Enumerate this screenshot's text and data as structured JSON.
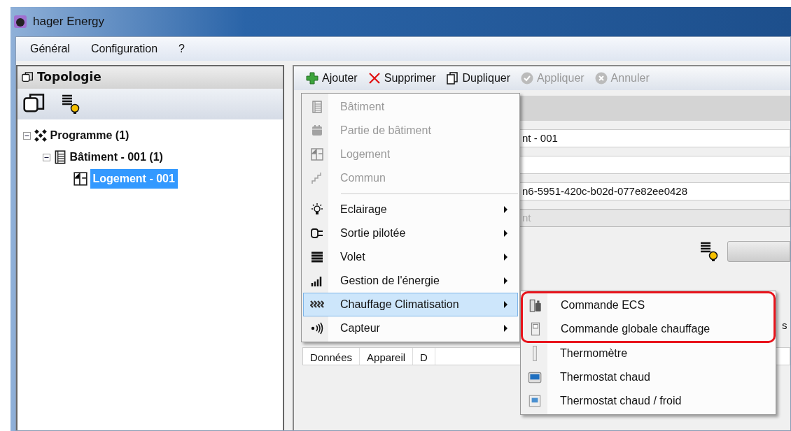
{
  "window": {
    "title": "hager Energy"
  },
  "menu_bar": [
    "Général",
    "Configuration",
    "?"
  ],
  "topology": {
    "title": "Topologie",
    "tree": [
      {
        "label": "Programme (1)",
        "kind": "program",
        "expanded": true,
        "selected": false,
        "children": [
          {
            "label": "Bâtiment - 001 (1)",
            "kind": "building",
            "expanded": true,
            "selected": false,
            "children": [
              {
                "label": "Logement - 001",
                "kind": "dwelling",
                "selected": true
              }
            ]
          }
        ]
      }
    ]
  },
  "toolbar": [
    {
      "label": "Ajouter",
      "kind": "add",
      "disabled": false
    },
    {
      "label": "Supprimer",
      "kind": "delete",
      "disabled": false
    },
    {
      "label": "Dupliquer",
      "kind": "duplicate",
      "disabled": false
    },
    {
      "label": "Appliquer",
      "kind": "apply",
      "disabled": true
    },
    {
      "label": "Annuler",
      "kind": "cancel",
      "disabled": true
    }
  ],
  "form": {
    "fields": [
      {
        "value": "nt - 001",
        "disabled": false
      },
      {
        "disabled": false
      },
      {
        "value": "n6-5951-420c-b02d-077e82ee0428",
        "disabled": false
      },
      {
        "value": "nt",
        "disabled": true
      }
    ],
    "side_label": "s"
  },
  "table": {
    "columns": [
      "Données",
      "Appareil",
      "D"
    ]
  },
  "context_menu": {
    "items": [
      {
        "label": "Bâtiment",
        "kind": "building",
        "disabled": true,
        "has_submenu": false,
        "selected": false
      },
      {
        "label": "Partie de bâtiment",
        "kind": "part",
        "disabled": true,
        "has_submenu": false,
        "selected": false
      },
      {
        "label": "Logement",
        "kind": "dwelling",
        "disabled": true,
        "has_submenu": false,
        "selected": false
      },
      {
        "label": "Commun",
        "kind": "stairs",
        "disabled": true,
        "has_submenu": false,
        "selected": false
      },
      {
        "kind": "separator"
      },
      {
        "label": "Eclairage",
        "kind": "light",
        "disabled": false,
        "has_submenu": true,
        "selected": false
      },
      {
        "label": "Sortie pilotée",
        "kind": "plug",
        "disabled": false,
        "has_submenu": true,
        "selected": false
      },
      {
        "label": "Volet",
        "kind": "shutter",
        "disabled": false,
        "has_submenu": true,
        "selected": false
      },
      {
        "label": "Gestion de l'énergie",
        "kind": "energy",
        "disabled": false,
        "has_submenu": true,
        "selected": false
      },
      {
        "label": "Chauffage Climatisation",
        "kind": "heating",
        "disabled": false,
        "has_submenu": true,
        "selected": true
      },
      {
        "label": "Capteur",
        "kind": "sensor",
        "disabled": false,
        "has_submenu": true,
        "selected": false
      }
    ]
  },
  "submenu": {
    "items": [
      {
        "label": "Commande ECS",
        "kind": "ecs",
        "highlighted": true
      },
      {
        "label": "Commande globale chauffage",
        "kind": "remote",
        "highlighted": true
      },
      {
        "label": "Thermomètre",
        "kind": "thermometer",
        "highlighted": false
      },
      {
        "label": "Thermostat chaud",
        "kind": "thermostat",
        "highlighted": false
      },
      {
        "label": "Thermostat chaud / froid",
        "kind": "thermostat2",
        "highlighted": false
      }
    ]
  }
}
